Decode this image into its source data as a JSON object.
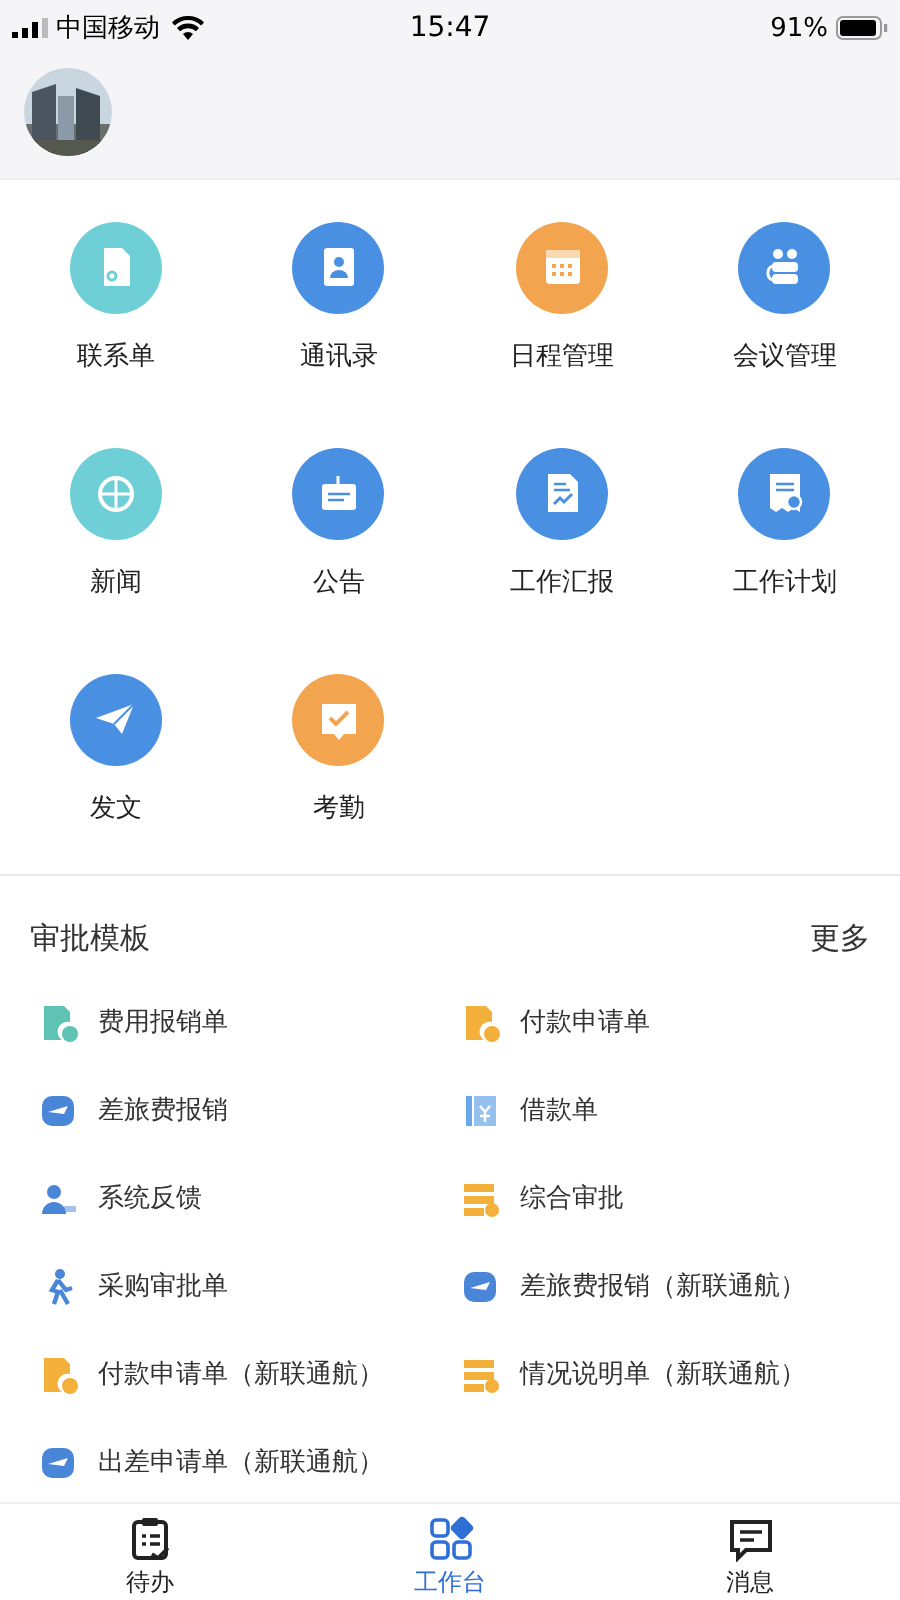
{
  "status_bar": {
    "carrier": "中国移动",
    "time": "15:47",
    "battery": "91%"
  },
  "apps": [
    {
      "label": "联系单",
      "color": "#6fcfd6"
    },
    {
      "label": "通讯录",
      "color": "#4a90e2"
    },
    {
      "label": "日程管理",
      "color": "#f2a54e"
    },
    {
      "label": "会议管理",
      "color": "#4a90e2"
    },
    {
      "label": "新闻",
      "color": "#6fcfd6"
    },
    {
      "label": "公告",
      "color": "#4a90e2"
    },
    {
      "label": "工作汇报",
      "color": "#4a90e2"
    },
    {
      "label": "工作计划",
      "color": "#4a90e2"
    },
    {
      "label": "发文",
      "color": "#4a90e2"
    },
    {
      "label": "考勤",
      "color": "#f2a54e"
    }
  ],
  "templates": {
    "title": "审批模板",
    "more": "更多",
    "items": [
      {
        "label": "费用报销单",
        "color": "#5fc3b4"
      },
      {
        "label": "付款申请单",
        "color": "#f3b13c"
      },
      {
        "label": "差旅费报销",
        "color": "#4a86d8"
      },
      {
        "label": "借款单",
        "color": "#6aa7e8"
      },
      {
        "label": "系统反馈",
        "color": "#4a86d8"
      },
      {
        "label": "综合审批",
        "color": "#f3b13c"
      },
      {
        "label": "采购审批单",
        "color": "#4a86d8"
      },
      {
        "label": "差旅费报销（新联通航）",
        "color": "#4a86d8"
      },
      {
        "label": "付款申请单（新联通航）",
        "color": "#f3b13c"
      },
      {
        "label": "情况说明单（新联通航）",
        "color": "#f3b13c"
      },
      {
        "label": "出差申请单（新联通航）",
        "color": "#4a86d8"
      }
    ]
  },
  "tabs": [
    {
      "label": "待办",
      "selected": false
    },
    {
      "label": "工作台",
      "selected": true
    },
    {
      "label": "消息",
      "selected": false
    }
  ]
}
